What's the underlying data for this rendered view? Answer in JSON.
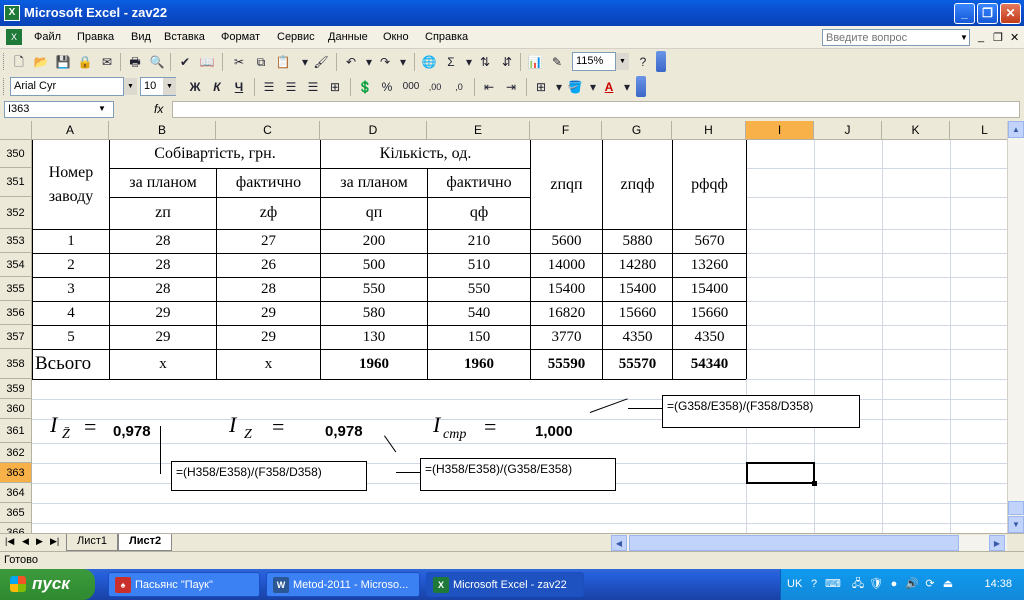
{
  "window": {
    "title": "Microsoft Excel - zav22",
    "app_icon": "excel-icon",
    "minimize": "_",
    "restore": "❐",
    "close": "✕"
  },
  "menu": {
    "items": [
      "Файл",
      "Правка",
      "Вид",
      "Вставка",
      "Формат",
      "Сервис",
      "Данные",
      "Окно",
      "Справка"
    ],
    "help_placeholder": "Введите вопрос",
    "doc_minimize": "_",
    "doc_restore": "❐",
    "doc_close": "✕"
  },
  "toolbar": {
    "zoom": "115%",
    "font_name": "Arial Cyr",
    "font_size": "10",
    "bold": "Ж",
    "italic": "К",
    "underline": "Ч",
    "percent": "%",
    "thousands": "000",
    "inc_decimal": ",00",
    "dec_decimal": ",0"
  },
  "formula_bar": {
    "name_box": "I363",
    "fx": "fx",
    "formula": ""
  },
  "grid": {
    "columns": [
      "A",
      "B",
      "C",
      "D",
      "E",
      "F",
      "G",
      "H",
      "I",
      "J",
      "K",
      "L"
    ],
    "active_column": "I",
    "rows": [
      "350",
      "351",
      "352",
      "353",
      "354",
      "355",
      "356",
      "357",
      "358",
      "359",
      "360",
      "361",
      "362",
      "363",
      "364",
      "365",
      "366"
    ],
    "active_row": "363"
  },
  "table": {
    "plant_header": "Номер заводу",
    "cost_header": "Собівартість, грн.",
    "qty_header": "Кількість, од.",
    "plan": "за планом",
    "actual": "фактично",
    "sym_zp": "zп",
    "sym_zf": "zф",
    "sym_qp": "qп",
    "sym_qf": "qф",
    "prod_zpqp": "zпqп",
    "prod_zpqf": "zпqф",
    "prod_pfqf": "pфqф",
    "rows": [
      [
        "1",
        "28",
        "27",
        "200",
        "210",
        "5600",
        "5880",
        "5670"
      ],
      [
        "2",
        "28",
        "26",
        "500",
        "510",
        "14000",
        "14280",
        "13260"
      ],
      [
        "3",
        "28",
        "28",
        "550",
        "550",
        "15400",
        "15400",
        "15400"
      ],
      [
        "4",
        "29",
        "29",
        "580",
        "540",
        "16820",
        "15660",
        "15660"
      ],
      [
        "5",
        "29",
        "29",
        "130",
        "150",
        "3770",
        "4350",
        "4350"
      ]
    ],
    "total": [
      "Всього",
      "x",
      "x",
      "1960",
      "1960",
      "55590",
      "55570",
      "54340"
    ]
  },
  "indices": {
    "i1_symbol": "I",
    "i1_sub": "Z̄",
    "i1_eq": "=",
    "i1_value": "0,978",
    "i2_symbol": "I",
    "i2_sub": "Z",
    "i2_eq": "=",
    "i2_value": "0,978",
    "i3_symbol": "I",
    "i3_sub": "стр",
    "i3_eq": "=",
    "i3_value": "1,000",
    "callout1": "=(H358/E358)/(F358/D358)",
    "callout2": "=(H358/E358)/(G358/E358)",
    "callout3": "=(G358/E358)/(F358/D358)"
  },
  "sheets": {
    "tabs": [
      "Лист1",
      "Лист2"
    ],
    "active": "Лист2"
  },
  "status": {
    "text": "Готово"
  },
  "taskbar": {
    "start": "пуск",
    "tasks": [
      "Пасьянс \"Паук\"",
      "Metod-2011 - Microso...",
      "Microsoft Excel - zav22"
    ],
    "lang": "UK",
    "time": "14:38"
  }
}
